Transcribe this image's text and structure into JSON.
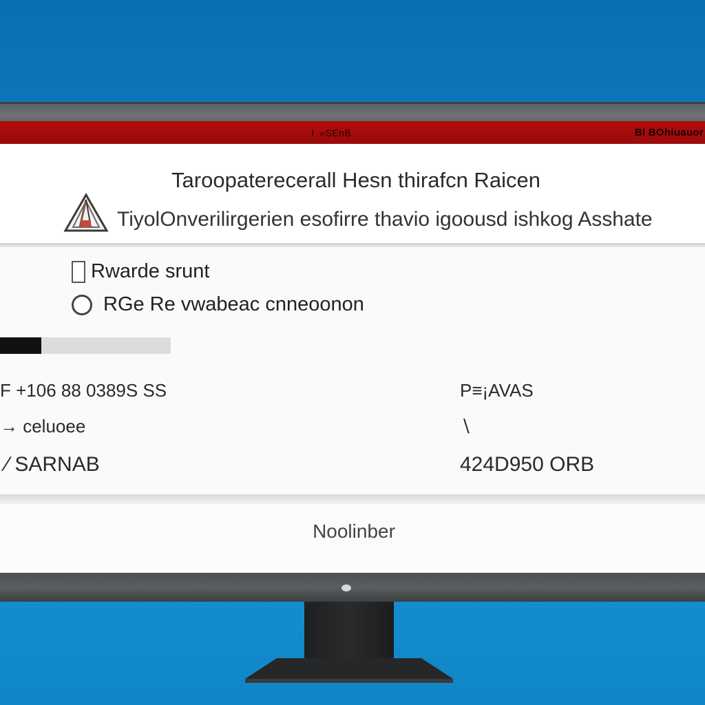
{
  "window": {
    "title": "I  »SEnB",
    "title_right": "Bl BOhiuauor"
  },
  "dialog": {
    "heading": "Taroopaterecerall Hesn thirafcn Raicen",
    "warning_text": "TiyolOnverilirgerien esofirre thavio igoousd ishkog Asshate",
    "warning_icon": "warning-triangle-icon"
  },
  "options": {
    "checkbox_label": "Rwarde srunt",
    "radio_label": "RGe Re vwabeac cnneoonon"
  },
  "progress": {
    "percent": 24
  },
  "details": {
    "left": [
      "F +106 88 0389S SS",
      "→ celuoee",
      "∕ SARNAB"
    ],
    "right": [
      "P≡¡AVAS",
      "∖",
      "424D950 ORB"
    ]
  },
  "footer": {
    "button_label": "Noolinber"
  },
  "colors": {
    "desktop": "#1283c6",
    "titlebar": "#a00b0b",
    "bezel": "#5a5d5f",
    "stand": "#222324"
  }
}
